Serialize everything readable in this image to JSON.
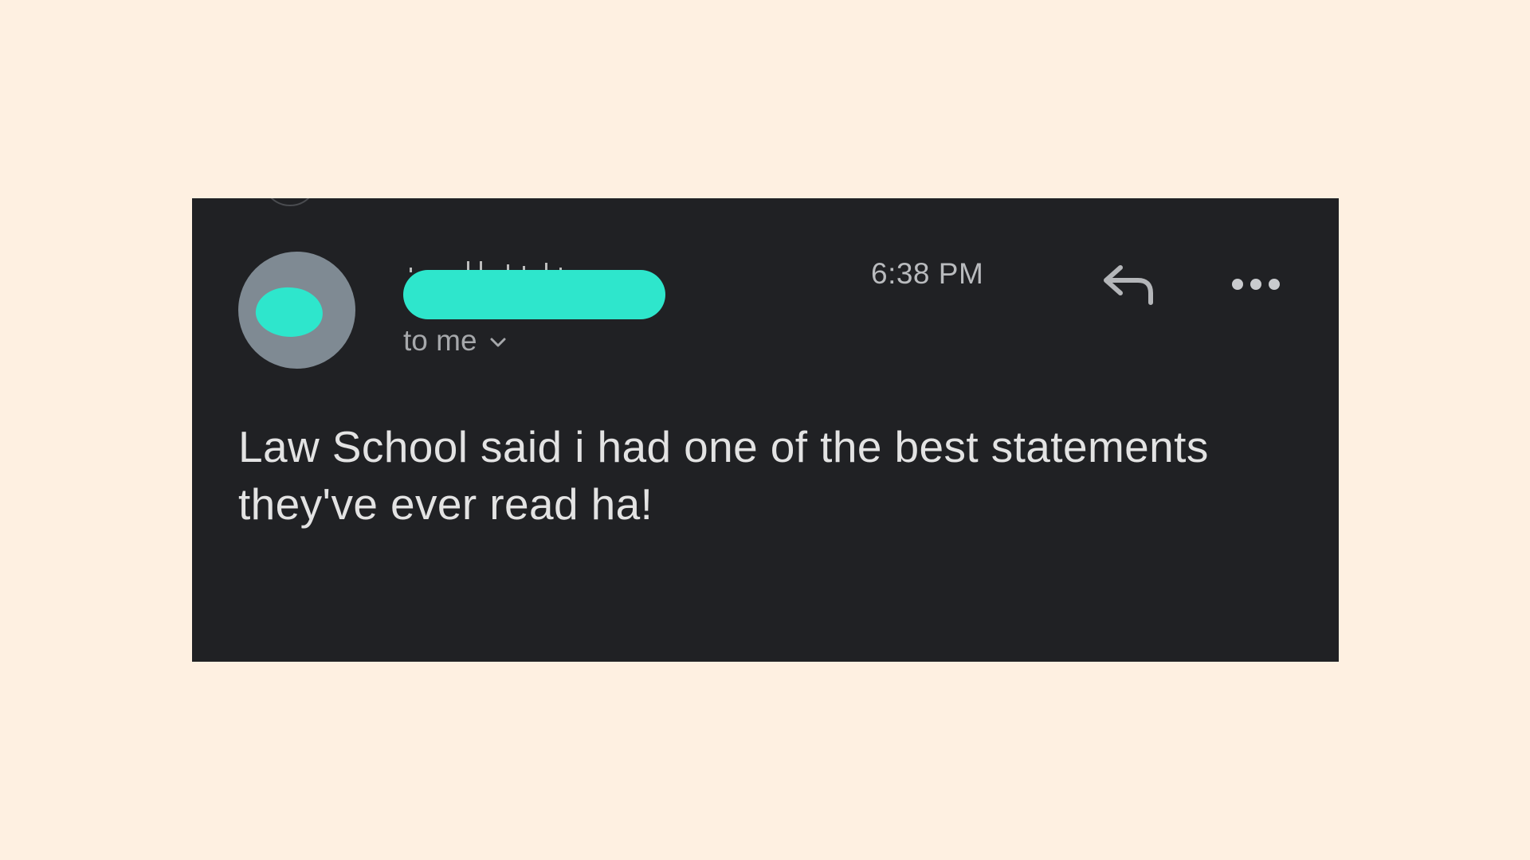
{
  "email": {
    "sender_name_redacted": true,
    "time": "6:38 PM",
    "recipient": "to me",
    "body": "Law School said i had one of the best statements they've ever read ha!"
  },
  "icons": {
    "reply": "reply-arrow-icon",
    "more": "more-horizontal-icon",
    "expand": "chevron-down-icon"
  },
  "colors": {
    "page_background": "#FEF0E1",
    "card_background": "#202124",
    "redaction": "#2EE6CC",
    "avatar": "#7F8A93",
    "body_text": "#E3E3E3",
    "secondary_text": "#A6A8AB"
  }
}
